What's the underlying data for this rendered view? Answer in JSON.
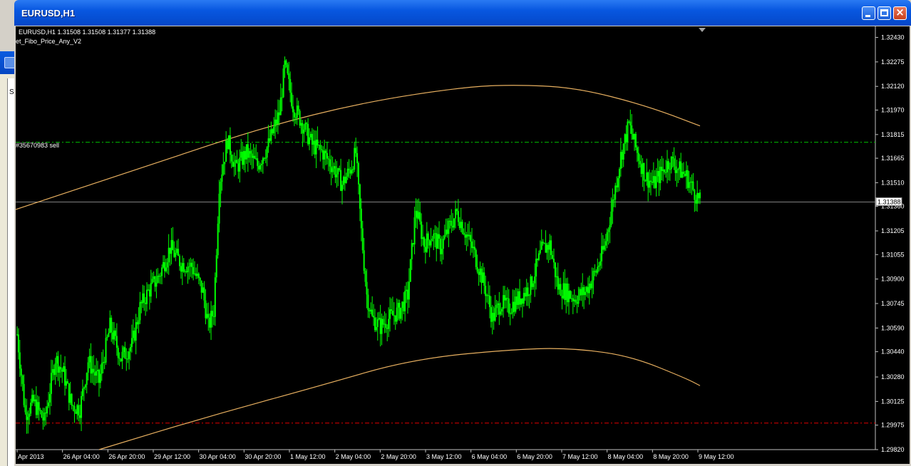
{
  "window": {
    "title": "EURUSD,H1",
    "controls": {
      "minimize_icon": "minimize-icon",
      "maximize_icon": "maximize-icon",
      "close_icon": "close-icon"
    }
  },
  "behind_window": {
    "fragment_text": "S"
  },
  "chart": {
    "symbol_info": "EURUSD,H1  1.31508 1.31508 1.31377 1.31388",
    "indicator_name": "et_Fibo_Price_Any_V2",
    "order_label": "#35670983 sell",
    "current_price_label": "1.31388",
    "colors": {
      "background": "#000000",
      "candles": "#00ff00",
      "curves": "#e8b060",
      "order_line": "#00c000",
      "stop_line": "#e00000",
      "price_line": "#808080",
      "axis_text": "#ffffff"
    }
  },
  "chart_data": {
    "type": "candlestick",
    "y_axis": {
      "ylim": [
        1.2982,
        1.325
      ],
      "ticks": [
        "1.32430",
        "1.32275",
        "1.32120",
        "1.31970",
        "1.31815",
        "1.31665",
        "1.31510",
        "1.31360",
        "1.31205",
        "1.31055",
        "1.30900",
        "1.30745",
        "1.30590",
        "1.30440",
        "1.30280",
        "1.30125",
        "1.29975",
        "1.29820"
      ]
    },
    "x_axis": {
      "ticks": [
        "Apr 2013",
        "26 Apr 04:00",
        "26 Apr 20:00",
        "29 Apr 12:00",
        "30 Apr 04:00",
        "30 Apr 20:00",
        "1 May 12:00",
        "2 May 04:00",
        "2 May 20:00",
        "3 May 12:00",
        "6 May 04:00",
        "6 May 20:00",
        "7 May 12:00",
        "8 May 04:00",
        "8 May 20:00",
        "9 May 12:00"
      ]
    },
    "current_price": 1.31388,
    "order_level": 1.31766,
    "stop_level": 1.29988,
    "price_path": [
      [
        0,
        1.3055
      ],
      [
        3,
        1.3005
      ],
      [
        6,
        1.3012
      ],
      [
        10,
        1.3
      ],
      [
        14,
        1.304
      ],
      [
        17,
        1.303
      ],
      [
        20,
        1.301
      ],
      [
        23,
        1.3008
      ],
      [
        26,
        1.3038
      ],
      [
        30,
        1.3025
      ],
      [
        34,
        1.306
      ],
      [
        38,
        1.304
      ],
      [
        42,
        1.3048
      ],
      [
        45,
        1.3072
      ],
      [
        48,
        1.3082
      ],
      [
        52,
        1.3092
      ],
      [
        56,
        1.311
      ],
      [
        60,
        1.31
      ],
      [
        64,
        1.3098
      ],
      [
        68,
        1.3082
      ],
      [
        70,
        1.306
      ],
      [
        72,
        1.307
      ],
      [
        74,
        1.315
      ],
      [
        77,
        1.3178
      ],
      [
        80,
        1.316
      ],
      [
        84,
        1.317
      ],
      [
        88,
        1.3162
      ],
      [
        92,
        1.3175
      ],
      [
        96,
        1.3195
      ],
      [
        98,
        1.3225
      ],
      [
        101,
        1.32
      ],
      [
        104,
        1.319
      ],
      [
        108,
        1.3175
      ],
      [
        112,
        1.317
      ],
      [
        116,
        1.316
      ],
      [
        119,
        1.315
      ],
      [
        122,
        1.316
      ],
      [
        124,
        1.317
      ],
      [
        126,
        1.312
      ],
      [
        128,
        1.308
      ],
      [
        130,
        1.3065
      ],
      [
        133,
        1.306
      ],
      [
        136,
        1.3065
      ],
      [
        140,
        1.307
      ],
      [
        143,
        1.308
      ],
      [
        146,
        1.3135
      ],
      [
        149,
        1.3112
      ],
      [
        152,
        1.3118
      ],
      [
        155,
        1.311
      ],
      [
        158,
        1.3122
      ],
      [
        161,
        1.3132
      ],
      [
        164,
        1.312
      ],
      [
        167,
        1.3108
      ],
      [
        170,
        1.3092
      ],
      [
        172,
        1.308
      ],
      [
        174,
        1.3065
      ],
      [
        177,
        1.3075
      ],
      [
        180,
        1.3072
      ],
      [
        184,
        1.3078
      ],
      [
        188,
        1.3086
      ],
      [
        192,
        1.3108
      ],
      [
        195,
        1.3112
      ],
      [
        198,
        1.3085
      ],
      [
        201,
        1.3082
      ],
      [
        204,
        1.3078
      ],
      [
        208,
        1.3082
      ],
      [
        212,
        1.3095
      ],
      [
        215,
        1.311
      ],
      [
        218,
        1.3138
      ],
      [
        221,
        1.3168
      ],
      [
        224,
        1.3188
      ],
      [
        227,
        1.317
      ],
      [
        230,
        1.3155
      ],
      [
        233,
        1.315
      ],
      [
        236,
        1.3158
      ],
      [
        239,
        1.3165
      ],
      [
        242,
        1.316
      ],
      [
        245,
        1.3155
      ],
      [
        248,
        1.3145
      ],
      [
        250,
        1.31388
      ]
    ],
    "upper_curve": [
      [
        -5,
        1.31315
      ],
      [
        50,
        1.3163
      ],
      [
        90,
        1.3186
      ],
      [
        127,
        1.3202
      ],
      [
        165,
        1.3212
      ],
      [
        185,
        1.3213
      ],
      [
        205,
        1.3211
      ],
      [
        230,
        1.32
      ],
      [
        250,
        1.3187
      ]
    ],
    "lower_curve": [
      [
        30,
        1.2982
      ],
      [
        70,
        1.3003
      ],
      [
        110,
        1.3022
      ],
      [
        145,
        1.30395
      ],
      [
        185,
        1.3046
      ],
      [
        205,
        1.3046
      ],
      [
        225,
        1.3041
      ],
      [
        245,
        1.3027
      ],
      [
        250,
        1.30225
      ]
    ]
  }
}
